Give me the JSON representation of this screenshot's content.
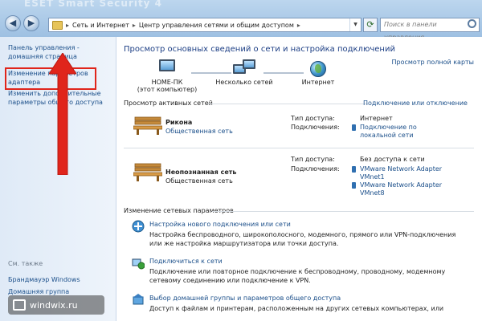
{
  "window": {
    "watermark_title": "ESET Smart Security 4"
  },
  "address": {
    "crumbs": [
      "Сеть и Интернет",
      "Центр управления сетями и общим доступом"
    ],
    "search_placeholder": "Поиск в панели управления"
  },
  "sidebar": {
    "items": [
      {
        "label": "Панель управления - домашняя страница"
      },
      {
        "label": "Изменение параметров адаптера"
      },
      {
        "label": "Изменить дополнительные параметры общего доступа"
      }
    ],
    "see_also_title": "См. также",
    "see_also": [
      {
        "label": "Брандмауэр Windows"
      },
      {
        "label": "Домашняя группа"
      }
    ]
  },
  "main": {
    "heading": "Просмотр основных сведений о сети и настройка подключений",
    "full_map_link": "Просмотр полной карты",
    "map": {
      "nodes": [
        {
          "label": "HOME-ПК",
          "sub": "(этот компьютер)"
        },
        {
          "label": "Несколько сетей",
          "sub": ""
        },
        {
          "label": "Интернет",
          "sub": ""
        }
      ]
    },
    "active_networks": {
      "title": "Просмотр активных сетей",
      "connect_link": "Подключение или отключение",
      "networks": [
        {
          "name": "Рикона",
          "type": "Общественная сеть",
          "access_label": "Тип доступа:",
          "access_value": "Интернет",
          "conn_label": "Подключения:",
          "connections": [
            "Подключение по",
            "локальной сети"
          ]
        },
        {
          "name": "Неопознанная сеть",
          "type": "Общественная сеть",
          "access_label": "Тип доступа:",
          "access_value": "Без доступа к сети",
          "conn_label": "Подключения:",
          "connections": [
            "VMware Network Adapter",
            "VMnet1",
            "VMware Network Adapter",
            "VMnet8"
          ]
        }
      ]
    },
    "settings": {
      "title": "Изменение сетевых параметров",
      "tasks": [
        {
          "link": "Настройка нового подключения или сети",
          "desc": [
            "Настройка беспроводного, широкополосного, модемного, прямого или VPN-подключения",
            "или же настройка маршрутизатора или точки доступа."
          ]
        },
        {
          "link": "Подключиться к сети",
          "desc": [
            "Подключение или повторное подключение к беспроводному, проводному, модемному",
            "сетевому соединению или подключение к VPN."
          ]
        },
        {
          "link": "Выбор домашней группы и параметров общего доступа",
          "desc": [
            "Доступ к файлам и принтерам, расположенным на других сетевых компьютерах, или"
          ]
        }
      ]
    }
  },
  "watermark": {
    "text": "windwix.ru"
  },
  "colors": {
    "link": "#1b4f8a",
    "heading": "#1c3e84",
    "highlight": "#e0251b"
  }
}
